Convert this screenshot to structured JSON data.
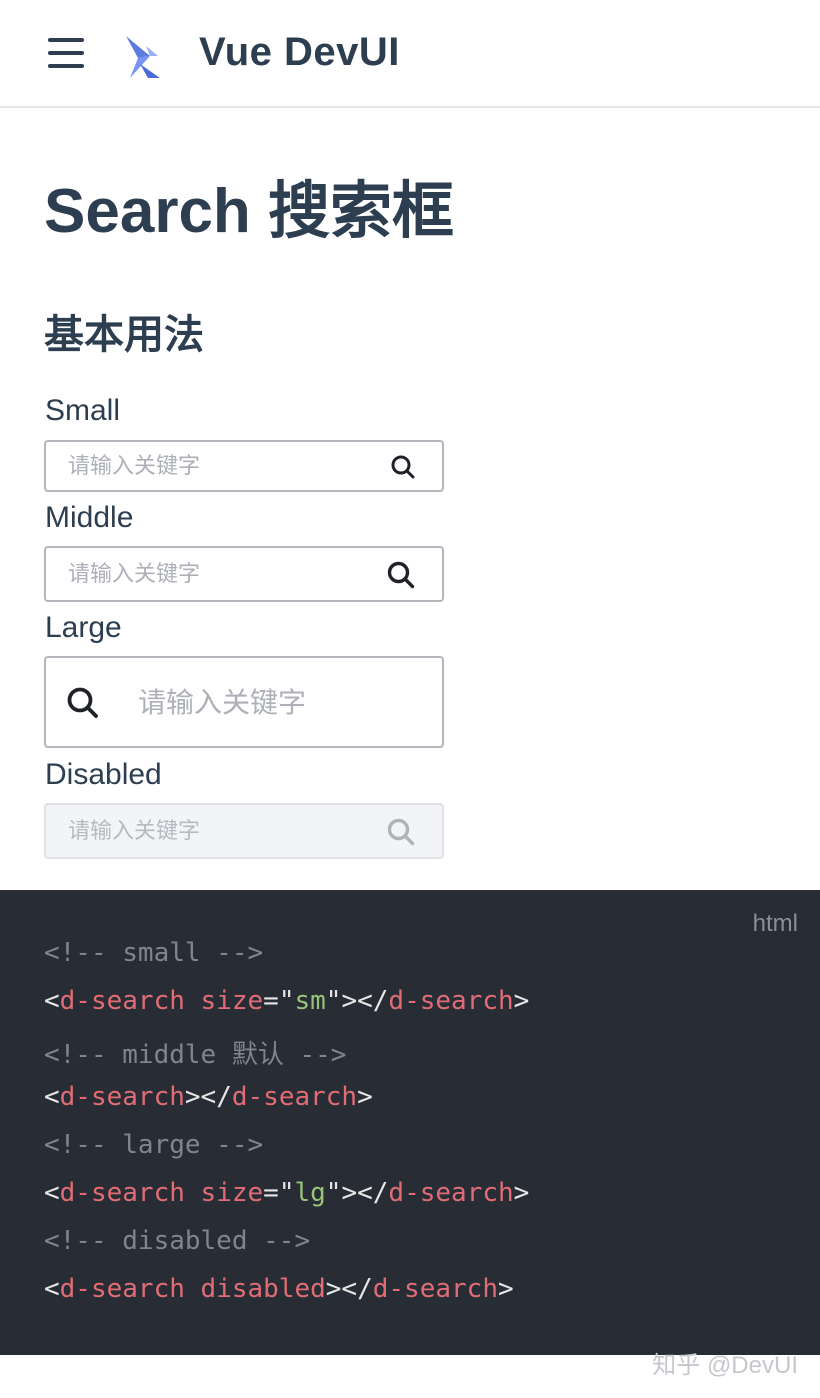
{
  "header": {
    "menu_icon": "hamburger-menu-icon",
    "logo_icon": "vue-devui-logo",
    "brand": "Vue DevUI"
  },
  "page": {
    "title": "Search 搜索框",
    "section_title": "基本用法"
  },
  "demos": {
    "small": {
      "label": "Small",
      "placeholder": "请输入关键字"
    },
    "middle": {
      "label": "Middle",
      "placeholder": "请输入关键字"
    },
    "large": {
      "label": "Large",
      "placeholder": "请输入关键字"
    },
    "disabled": {
      "label": "Disabled",
      "placeholder": "请输入关键字"
    }
  },
  "code": {
    "language": "html",
    "lines": [
      {
        "comment": "<!-- small -->"
      },
      {
        "open": "<",
        "tag": "d-search",
        "attr": " size",
        "eq": "=\"",
        "val": "sm",
        "close_q": "\">",
        "end_open": "</",
        "end_tag": "d-search",
        "end": ">"
      },
      {
        "comment": "<!-- middle 默认 -->"
      },
      {
        "open": "<",
        "tag": "d-search",
        "close": "></",
        "end_tag": "d-search",
        "end": ">"
      },
      {
        "comment": "<!-- large -->"
      },
      {
        "open": "<",
        "tag": "d-search",
        "attr": " size",
        "eq": "=\"",
        "val": "lg",
        "close_q": "\">",
        "end_open": "</",
        "end_tag": "d-search",
        "end": ">"
      },
      {
        "comment": "<!-- disabled -->"
      },
      {
        "open": "<",
        "tag": "d-search",
        "attr": " disabled",
        "close": "></",
        "end_tag": "d-search",
        "end": ">"
      }
    ]
  },
  "watermark": "知乎 @DevUI",
  "colors": {
    "text": "#2c3e50",
    "code_bg": "#282c34",
    "code_tag": "#e06c75",
    "code_string": "#98c379",
    "code_comment": "#7f848e"
  }
}
